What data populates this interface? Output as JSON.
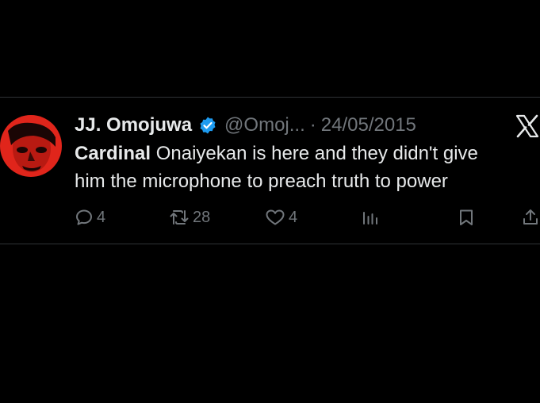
{
  "tweet": {
    "author_name": "JJ. Omojuwa",
    "handle": "@Omoj...",
    "separator": "·",
    "date": "24/05/2015",
    "text_bold": "Cardinal",
    "text_line1_rest": " Onaiyekan is here and they didn't give",
    "text_line2": "him the microphone to preach truth to power",
    "verified": true
  },
  "actions": {
    "replies": "4",
    "retweets": "28",
    "likes": "4"
  },
  "icons": {
    "reply": "speech-bubble-icon",
    "retweet": "retweet-icon",
    "like": "heart-icon",
    "views": "bar-chart-icon",
    "bookmark": "bookmark-icon",
    "share": "share-icon",
    "brand": "x-logo-icon",
    "verified": "verified-badge-icon"
  },
  "colors": {
    "background": "#000000",
    "text": "#e7e9ea",
    "muted": "#71767b",
    "divider": "#2f3336",
    "verified_blue": "#1d9bf0",
    "avatar_red": "#e0251b"
  }
}
